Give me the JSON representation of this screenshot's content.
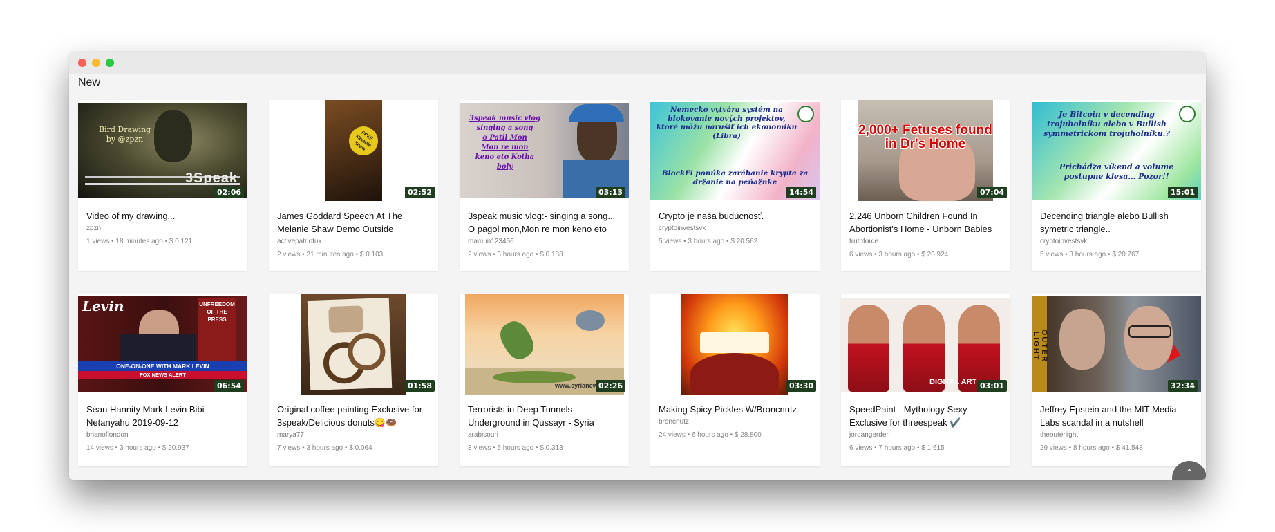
{
  "section_title": "New",
  "videos": [
    {
      "title": "Video of my drawing...",
      "author": "zpzn",
      "views": "1 views",
      "age": "18 minutes ago",
      "payout": "$ 0.121",
      "duration": "02:06",
      "thumb_text": "Bird Drawing\nby @zpzn",
      "thumb_logo": "3Speak"
    },
    {
      "title": "James Goddard Speech At The Melanie Shaw Demo Outside",
      "author": "activepatriotuk",
      "views": "2 views",
      "age": "21 minutes ago",
      "payout": "$ 0.103",
      "duration": "02:52",
      "thumb_text": "FREE Melanie Shaw"
    },
    {
      "title": "3speak music vlog:- singing a song.., O pagol mon,Mon re mon keno eto",
      "author": "mamun123456",
      "views": "2 views",
      "age": "3 hours ago",
      "payout": "$ 0.188",
      "duration": "03:13",
      "thumb_text": "3speak music vlog\nsinging a song\no Patil Mon\nMon re mon\nkeno eto Kotha\nboly"
    },
    {
      "title": "Crypto je naša budúcnosť.",
      "author": "cryptoinvestsvk",
      "views": "5 views",
      "age": "3 hours ago",
      "payout": "$ 20.562",
      "duration": "14:54",
      "thumb_text": "Nemecko vytvára systém na blokovanie nových projektov, ktoré môžu narušiť ich ekonomiku (Libra)",
      "thumb_text2": "BlockFi ponúka zarábanie krypta za držanie na peňažnke"
    },
    {
      "title": "2,246 Unborn Children Found In Abortionist's Home - Unborn Babies",
      "author": "truthforce",
      "views": "6 views",
      "age": "3 hours ago",
      "payout": "$ 20.924",
      "duration": "07:04",
      "thumb_text": "2,000+ Fetuses found in Dr's Home"
    },
    {
      "title": "Decending triangle alebo Bullish symetric triangle..",
      "author": "cryptoinvestsvk",
      "views": "5 views",
      "age": "3 hours ago",
      "payout": "$ 20.767",
      "duration": "15:01",
      "thumb_text": "Je Bitcoin v decending trojuholníku alebo v Bullish symmetrickom trojuholníku.?",
      "thumb_text2": "Prichádza víkend a volume postupne klesa… Pozor!!"
    },
    {
      "title": "Sean Hannity Mark Levin Bibi Netanyahu 2019-09-12",
      "author": "brianoflondon",
      "views": "14 views",
      "age": "3 hours ago",
      "payout": "$ 20.937",
      "duration": "06:54",
      "thumb_text": "ONE-ON-ONE WITH MARK LEVIN",
      "thumb_logo": "Levin",
      "thumb_text2": "UNFREEDOM OF THE PRESS",
      "thumb_text3": "FOX NEWS ALERT"
    },
    {
      "title": "Original coffee painting Exclusive for 3speak/Delicious donuts😋🍩",
      "author": "marya77",
      "views": "7 views",
      "age": "3 hours ago",
      "payout": "$ 0.064",
      "duration": "01:58"
    },
    {
      "title": "Terrorists in Deep Tunnels Underground in Qussayr - Syria",
      "author": "arabisouri",
      "views": "3 views",
      "age": "5 hours ago",
      "payout": "$ 0.313",
      "duration": "02:26",
      "thumb_text": "www.syrianews.cc"
    },
    {
      "title": "Making Spicy Pickles W/Broncnutz",
      "author": "broncnutz",
      "views": "24 views",
      "age": "6 hours ago",
      "payout": "$ 28.800",
      "duration": "03:30"
    },
    {
      "title": "SpeedPaint - Mythology Sexy - Exclusive for threespeak ✔️",
      "author": "jordangerder",
      "views": "6 views",
      "age": "7 hours ago",
      "payout": "$ 1.615",
      "duration": "03:01",
      "thumb_text": "DIGITAL ART"
    },
    {
      "title": "Jeffrey Epstein and the MIT Media Labs scandal in a nutshell",
      "author": "theouterlight",
      "views": "29 views",
      "age": "8 hours ago",
      "payout": "$ 41.548",
      "duration": "32:34",
      "thumb_text": "OUTER LIGHT"
    }
  ],
  "colors": {
    "duration_bg": "#1f3d1f",
    "window_bg": "#f4f4f4"
  },
  "icons": {
    "scroll_top": "chevron-up-icon"
  }
}
